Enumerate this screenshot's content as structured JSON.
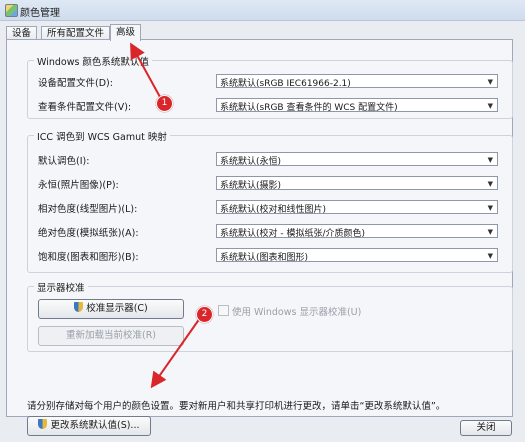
{
  "window": {
    "title": "颜色管理"
  },
  "tabs": [
    {
      "label": "设备"
    },
    {
      "label": "所有配置文件"
    },
    {
      "label": "高级"
    }
  ],
  "windows_defaults": {
    "legend": "Windows 颜色系统默认值",
    "rows": [
      {
        "label": "设备配置文件(D):",
        "value": "系统默认(sRGB IEC61966-2.1)"
      },
      {
        "label": "查看条件配置文件(V):",
        "value": "系统默认(sRGB 查看条件的 WCS 配置文件)"
      }
    ]
  },
  "gamut_mapping": {
    "legend": "ICC 调色到 WCS Gamut 映射",
    "rows": [
      {
        "label": "默认调色(I):",
        "value": "系统默认(永恒)"
      },
      {
        "label": "永恒(照片图像)(P):",
        "value": "系统默认(摄影)"
      },
      {
        "label": "相对色度(线型图片)(L):",
        "value": "系统默认(校对和线性图片)"
      },
      {
        "label": "绝对色度(模拟纸张)(A):",
        "value": "系统默认(校对 - 模拟纸张/介质颜色)"
      },
      {
        "label": "饱和度(图表和图形)(B):",
        "value": "系统默认(图表和图形)"
      }
    ]
  },
  "calibration": {
    "legend": "显示器校准",
    "calibrate_button": "校准显示器(C)",
    "reload_button": "重新加载当前校准(R)",
    "checkbox_label": "使用 Windows 显示器校准(U)",
    "checkbox_checked": false
  },
  "note": "请分别存储对每个用户的颜色设置。要对新用户和共享打印机进行更改，请单击“更改系统默认值”。",
  "change_defaults_button": "更改系统默认值(S)...",
  "close_button": "关闭",
  "annotations": [
    {
      "label": "1"
    },
    {
      "label": "2"
    }
  ],
  "colors": {
    "annotation": "#d8262a",
    "window_bg": "#f4f6f9"
  }
}
